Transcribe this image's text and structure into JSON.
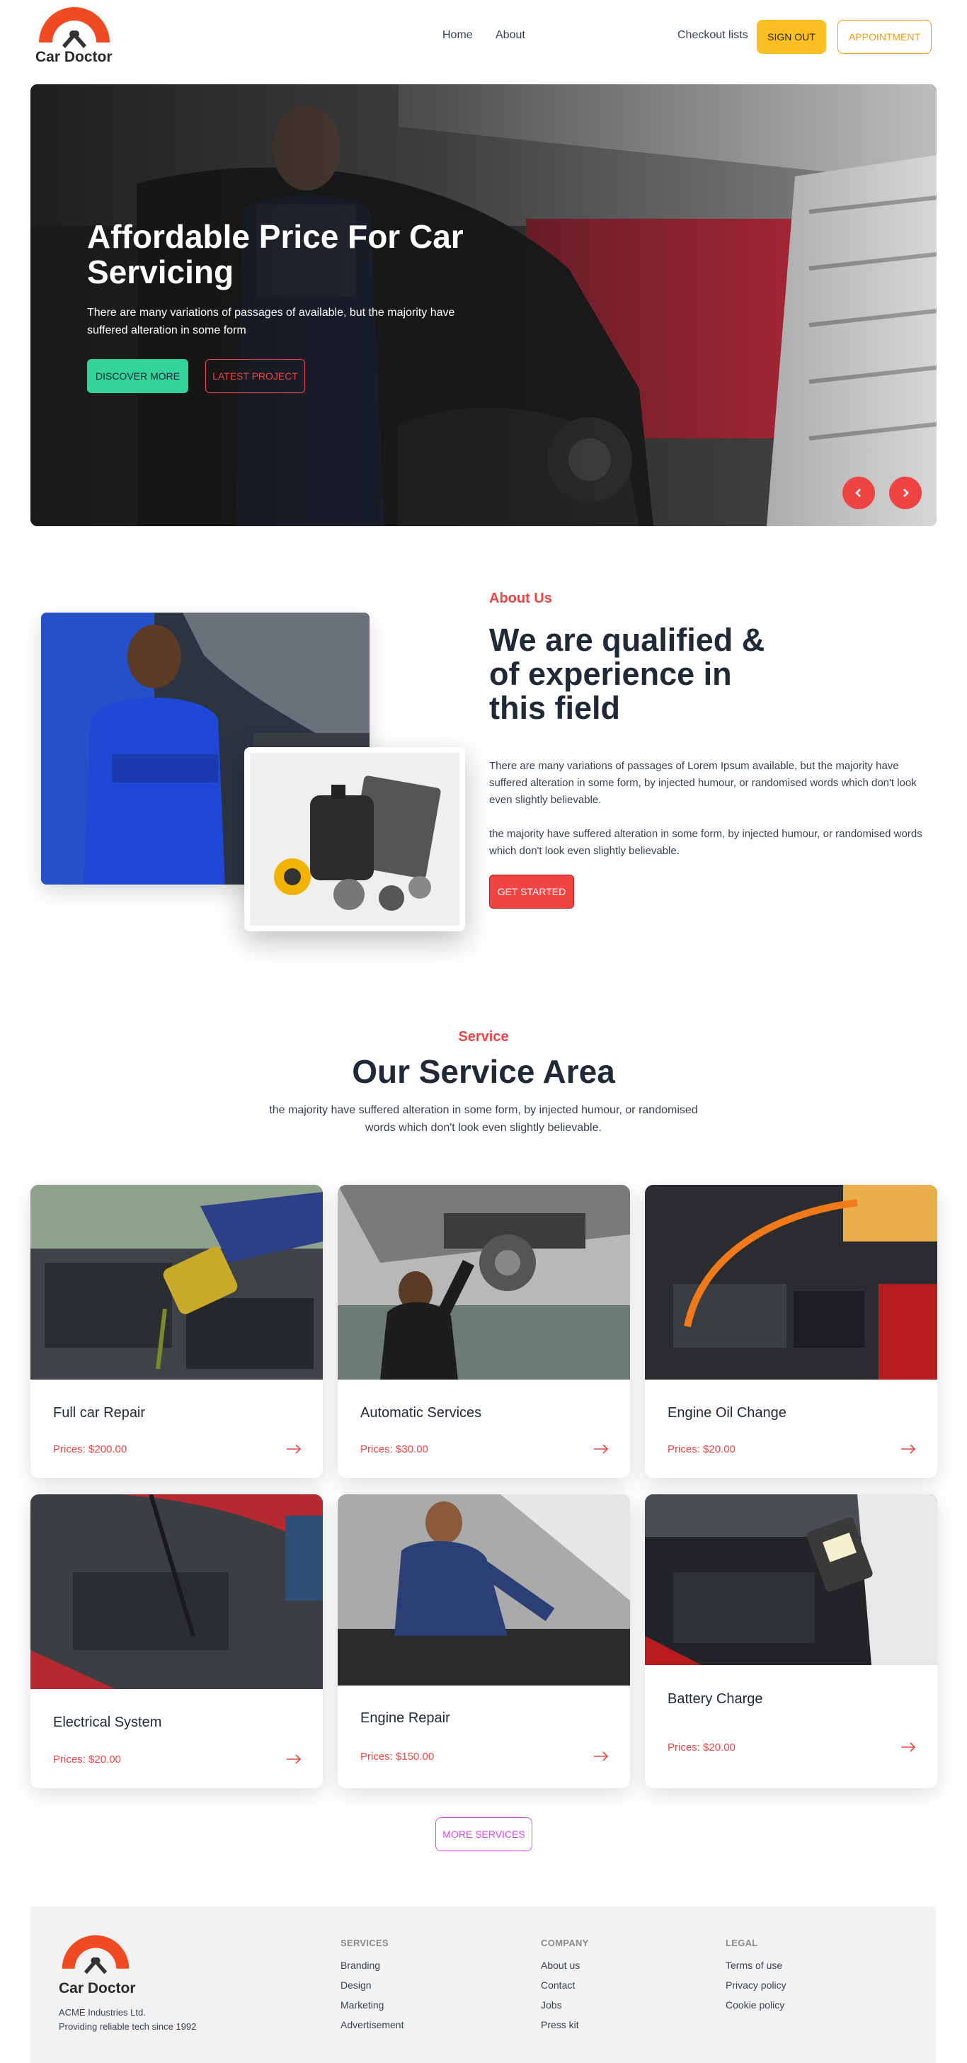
{
  "nav": {
    "brand": "Car Doctor",
    "links": [
      "Home",
      "About"
    ],
    "checkout": "Checkout lists",
    "signout": "SIGN OUT",
    "appointment": "APPOINTMENT"
  },
  "hero": {
    "title": "Affordable Price For Car Servicing",
    "text": "There are many variations of passages of available, but the majority have suffered alteration in some form",
    "discover": "DISCOVER MORE",
    "latest": "LATEST PROJECT"
  },
  "about": {
    "eyebrow": "About Us",
    "title": "We are qualified & of experience in this field",
    "p1": "There are many variations of passages of Lorem Ipsum available, but the majority have suffered alteration in some form, by injected humour, or randomised words which don't look even slightly believable.",
    "p2": "the majority have suffered alteration in some form, by injected humour, or randomised words which don't look even slightly believable.",
    "cta": "GET STARTED"
  },
  "services": {
    "eyebrow": "Service",
    "title": "Our Service Area",
    "subtitle": "the majority have suffered alteration in some form, by injected humour, or randomised words which don't look even slightly believable.",
    "items": [
      {
        "title": "Full car Repair",
        "price": "Prices: $200.00"
      },
      {
        "title": "Automatic Services",
        "price": "Prices: $30.00"
      },
      {
        "title": "Engine Oil Change",
        "price": "Prices: $20.00"
      },
      {
        "title": "Electrical System",
        "price": "Prices: $20.00"
      },
      {
        "title": "Engine Repair",
        "price": "Prices: $150.00"
      },
      {
        "title": "Battery Charge",
        "price": "Prices: $20.00"
      }
    ],
    "more": "MORE SERVICES"
  },
  "footer": {
    "brand": "Car Doctor",
    "line1": "ACME Industries Ltd.",
    "line2": "Providing reliable tech since 1992",
    "columns": [
      {
        "head": "SERVICES",
        "links": [
          "Branding",
          "Design",
          "Marketing",
          "Advertisement"
        ]
      },
      {
        "head": "COMPANY",
        "links": [
          "About us",
          "Contact",
          "Jobs",
          "Press kit"
        ]
      },
      {
        "head": "LEGAL",
        "links": [
          "Terms of use",
          "Privacy policy",
          "Cookie policy"
        ]
      }
    ]
  },
  "colors": {
    "accent_red": "#ef4444",
    "accent_yellow": "#fbbf24",
    "accent_green": "#34d399",
    "accent_pink": "#d946ef",
    "logo_orange": "#f04a23"
  }
}
